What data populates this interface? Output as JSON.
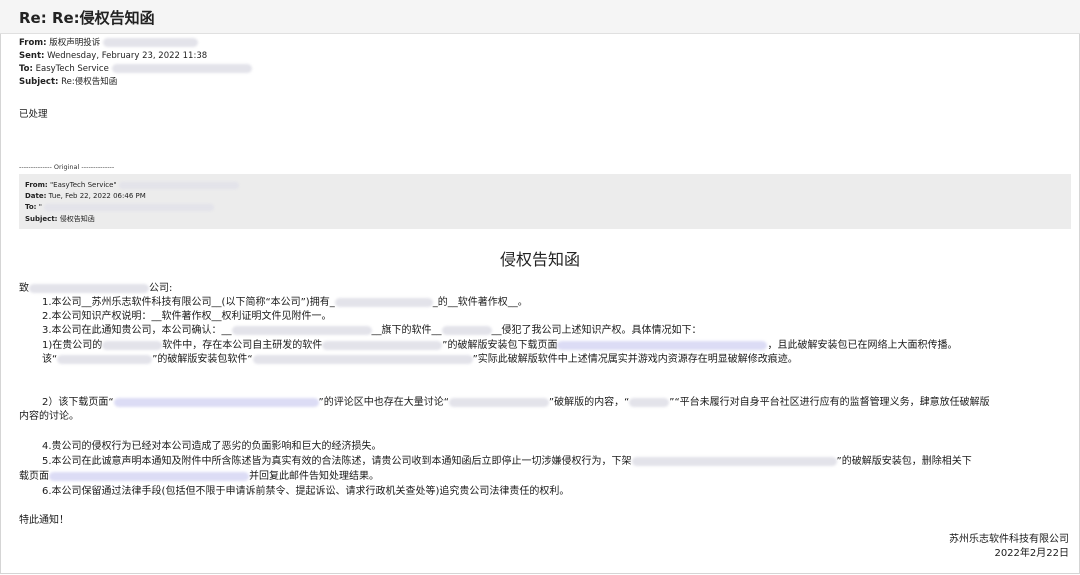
{
  "email": {
    "subject_title": "Re: Re:侵权告知函",
    "from_label": "From:",
    "from_value": "版权声明投诉",
    "sent_label": "Sent:",
    "sent_value": "Wednesday, February 23, 2022 11:38",
    "to_label": "To:",
    "to_value": "EasyTech Service",
    "subject_label": "Subject:",
    "subject_value": "Re:侵权告知函",
    "reply_body": "已处理"
  },
  "original": {
    "divider": "-------------- Original --------------",
    "from_label": "From:",
    "from_value": "\"EasyTech Service\"",
    "date_label": "Date:",
    "date_value": "Tue, Feb 22, 2022 06:46 PM",
    "to_label": "To:",
    "to_value": "\"",
    "subject_label": "Subject:",
    "subject_value": "侵权告知函"
  },
  "letter": {
    "title": "侵权告知函",
    "greeting_pre": "致",
    "greeting_post": "公司:",
    "l1a": "1.本公司__苏州乐志软件科技有限公司__(以下简称“本公司”)拥有_",
    "l1b": "_的__软件著作权__。",
    "l2": "2.本公司知识产权说明：__软件著作权__权利证明文件见附件一。",
    "l3a": "3.本公司在此通知贵公司，本公司确认：__",
    "l3b": "__旗下的软件__",
    "l3c": "__侵犯了我公司上述知识产权。具体情况如下：",
    "l4a": "1)在贵公司的",
    "l4b": "软件中，存在本公司自主研发的软件",
    "l4c": "”的破解版安装包下载页面",
    "l4d": "，且此破解安装包已在网络上大面积传播。",
    "l5a": "该“",
    "l5b": "”的破解版安装包软件“",
    "l5c": "”实际此破解版软件中上述情况属实并游戏内资源存在明显破解修改痕迹。",
    "l6a": "2）该下载页面“",
    "l6b": "”的评论区中也存在大量讨论“",
    "l6c": "”破解版的内容，“",
    "l6d": "”“平台未履行对自身平台社区进行应有的监督管理义务，肆意放任破解版",
    "l6e": "内容的讨论。",
    "l7": "4.贵公司的侵权行为已经对本公司造成了恶劣的负面影响和巨大的经济损失。",
    "l8a": "5.本公司在此诚意声明本通知及附件中所含陈述皆为真实有效的合法陈述，请贵公司收到本通知函后立即停止一切涉嫌侵权行为，下架",
    "l8b": "”的破解版安装包，删除相关下",
    "l8c": "载页面",
    "l8d": "并回复此邮件告知处理结果。",
    "l9": "6.本公司保留通过法律手段(包括但不限于申请诉前禁令、提起诉讼、请求行政机关查处等)追究贵公司法律责任的权利。",
    "closing": "特此通知！",
    "sig_company": "苏州乐志软件科技有限公司",
    "sig_date": "2022年2月22日"
  }
}
